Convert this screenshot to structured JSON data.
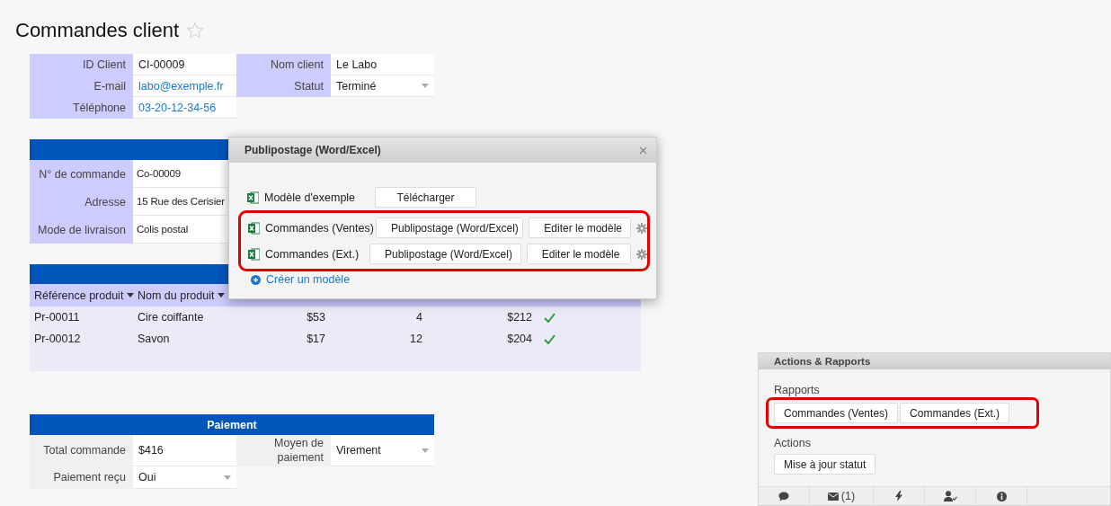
{
  "page": {
    "title": "Commandes client",
    "favorite": false
  },
  "customer": {
    "rows": [
      [
        {
          "label": "ID Client",
          "value": "CI-00009",
          "kind": "text"
        },
        {
          "label": "Nom client",
          "value": "Le Labo",
          "kind": "text"
        }
      ],
      [
        {
          "label": "E-mail",
          "value": "labo@exemple.fr",
          "kind": "link"
        },
        {
          "label": "Statut",
          "value": "Terminé",
          "kind": "select"
        }
      ],
      [
        {
          "label": "Téléphone",
          "value": "03-20-12-34-56",
          "kind": "link"
        }
      ]
    ]
  },
  "order": {
    "rows": [
      [
        {
          "label": "N° de commande",
          "value": "Co-00009",
          "kind": "text"
        }
      ],
      [
        {
          "label": "Adresse",
          "value": "15 Rue des Cerisier",
          "kind": "text"
        }
      ],
      [
        {
          "label": "Mode de livraison",
          "value": "Colis postal",
          "kind": "text"
        }
      ]
    ]
  },
  "products": {
    "columns": [
      {
        "label": "Référence produit"
      },
      {
        "label": "Nom du produit"
      }
    ],
    "rows": [
      {
        "cells": [
          "Pr-00011",
          "Cire coiffante",
          "$53",
          "4",
          "$212"
        ],
        "shipped": true
      },
      {
        "cells": [
          "Pr-00012",
          "Savon",
          "$17",
          "12",
          "$204"
        ],
        "shipped": true
      }
    ]
  },
  "payment": {
    "title": "Paiement",
    "rows": [
      [
        {
          "label": "Total commande",
          "value": "$416",
          "kind": "text"
        },
        {
          "label": "Moyen de paiement",
          "value": "Virement",
          "kind": "select"
        }
      ],
      [
        {
          "label": "Paiement reçu",
          "value": "Oui",
          "kind": "select"
        }
      ]
    ]
  },
  "dialog": {
    "title": "Publipostage (Word/Excel)",
    "items": [
      {
        "kind": "sample",
        "name": "Modèle d'exemple",
        "buttons": [
          "Télécharger"
        ],
        "highlighted": false
      },
      {
        "kind": "template",
        "name": "Commandes (Ventes)",
        "buttons": [
          "Publipostage (Word/Excel)",
          "Editer le modèle"
        ],
        "highlighted": true
      },
      {
        "kind": "template",
        "name": "Commandes (Ext.)",
        "buttons": [
          "Publipostage (Word/Excel)",
          "Editer le modèle"
        ],
        "highlighted": true
      }
    ],
    "create_link": "Créer un modèle"
  },
  "panel": {
    "title": "Actions & Rapports",
    "sections": [
      {
        "label": "Rapports",
        "buttons": [
          "Commandes (Ventes)",
          "Commandes (Ext.)"
        ],
        "highlighted": true
      },
      {
        "label": "Actions",
        "buttons": [
          "Mise à jour statut"
        ],
        "highlighted": false
      }
    ],
    "footer": [
      {
        "kind": "comment"
      },
      {
        "kind": "mail",
        "count": "(1)"
      },
      {
        "kind": "bolt"
      },
      {
        "kind": "user-check"
      },
      {
        "kind": "info"
      }
    ]
  }
}
